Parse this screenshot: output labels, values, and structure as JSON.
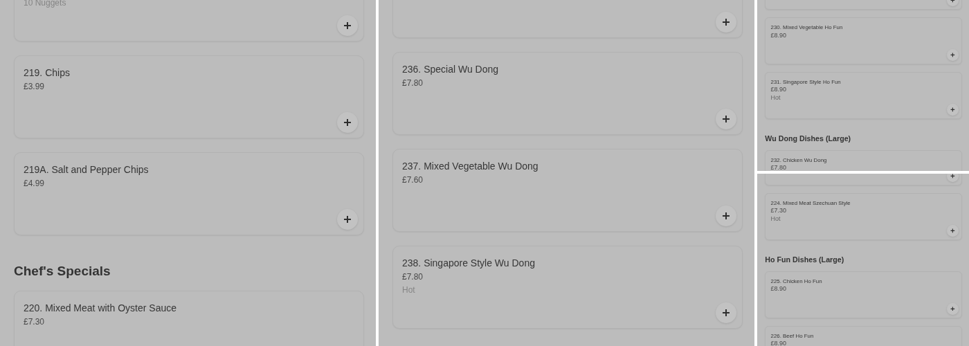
{
  "panels": [
    {
      "items": [
        {
          "kind": "card",
          "note": "10 Nuggets"
        },
        {
          "kind": "card",
          "title": "219. Chips",
          "price": "£3.99"
        },
        {
          "kind": "card",
          "title": "219A. Salt and Pepper Chips",
          "price": "£4.99"
        },
        {
          "kind": "heading",
          "text": "Chef's Specials"
        },
        {
          "kind": "card",
          "title": "220. Mixed Meat with Oyster Sauce",
          "price": "£7.30",
          "add": false
        }
      ]
    },
    {
      "items": [
        {
          "kind": "card"
        },
        {
          "kind": "card",
          "title": "236. Special Wu Dong",
          "price": "£7.80"
        },
        {
          "kind": "card",
          "title": "237. Mixed Vegetable Wu Dong",
          "price": "£7.60"
        },
        {
          "kind": "card",
          "title": "238. Singapore Style Wu Dong",
          "price": "£7.80",
          "note": "Hot"
        }
      ]
    },
    {
      "items": [
        {
          "kind": "card"
        },
        {
          "kind": "card",
          "title": "230. Mixed Vegetable Ho Fun",
          "price": "£8.90"
        },
        {
          "kind": "card",
          "title": "231. Singapore Style Ho Fun",
          "price": "£8.90",
          "note": "Hot"
        },
        {
          "kind": "heading",
          "text": "Wu Dong Dishes (Large)"
        },
        {
          "kind": "card",
          "title": "232. Chicken Wu Dong",
          "price": "£7.80",
          "add": false
        }
      ]
    },
    {
      "items": [
        {
          "kind": "card"
        },
        {
          "kind": "card",
          "title": "224. Mixed Meat Szechuan Style",
          "price": "£7.30",
          "note": "Hot"
        },
        {
          "kind": "heading",
          "text": "Ho Fun Dishes (Large)"
        },
        {
          "kind": "card",
          "title": "225. Chicken Ho Fun",
          "price": "£8.90"
        },
        {
          "kind": "card",
          "title": "226. Beef Ho Fun",
          "price": "£8.90",
          "add": false
        }
      ]
    }
  ]
}
